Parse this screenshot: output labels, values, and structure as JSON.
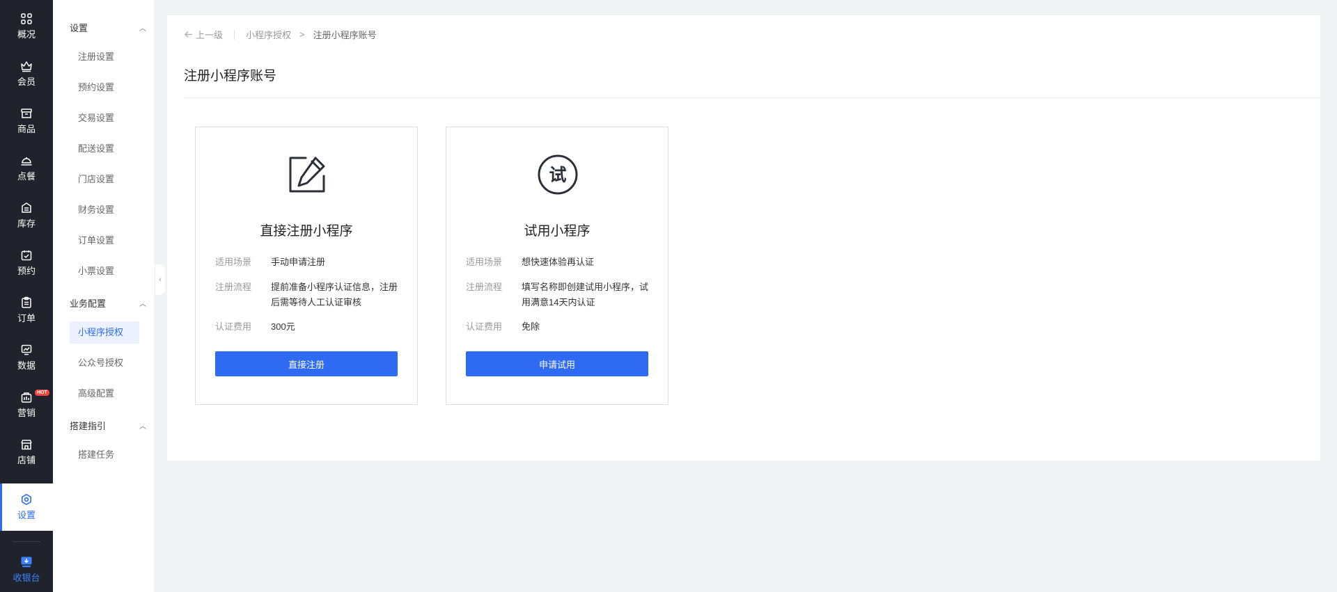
{
  "nav": {
    "items": [
      {
        "label": "概况",
        "icon": "grid-icon"
      },
      {
        "label": "会员",
        "icon": "crown-icon"
      },
      {
        "label": "商品",
        "icon": "shop-box-icon"
      },
      {
        "label": "点餐",
        "icon": "dish-icon"
      },
      {
        "label": "库存",
        "icon": "inventory-icon"
      },
      {
        "label": "预约",
        "icon": "calendar-check-icon"
      },
      {
        "label": "订单",
        "icon": "clipboard-icon"
      },
      {
        "label": "数据",
        "icon": "chart-icon"
      },
      {
        "label": "营销",
        "icon": "marketing-icon",
        "badge": "HOT"
      },
      {
        "label": "店铺",
        "icon": "store-icon"
      },
      {
        "label": "设置",
        "icon": "settings-icon",
        "active": true
      }
    ],
    "cashier": {
      "label": "收银台",
      "icon": "cashier-icon"
    }
  },
  "sidebar": {
    "groups": [
      {
        "label": "设置",
        "items": [
          "注册设置",
          "预约设置",
          "交易设置",
          "配送设置",
          "门店设置",
          "财务设置",
          "订单设置",
          "小票设置"
        ]
      },
      {
        "label": "业务配置",
        "items": [
          "小程序授权",
          "公众号授权",
          "高级配置"
        ]
      },
      {
        "label": "搭建指引",
        "items": [
          "搭建任务"
        ]
      }
    ],
    "active_item": "小程序授权"
  },
  "breadcrumb": {
    "back": "上一级",
    "parent": "小程序授权",
    "separator": ">",
    "current": "注册小程序账号"
  },
  "page_title": "注册小程序账号",
  "cards": [
    {
      "icon": "edit-document-icon",
      "title": "直接注册小程序",
      "rows": [
        {
          "key": "适用场景",
          "value": "手动申请注册"
        },
        {
          "key": "注册流程",
          "value": "提前准备小程序认证信息，注册后需等待人工认证审核"
        },
        {
          "key": "认证费用",
          "value": "300元"
        }
      ],
      "button": "直接注册"
    },
    {
      "icon": "trial-circle-icon",
      "icon_glyph": "试",
      "title": "试用小程序",
      "rows": [
        {
          "key": "适用场景",
          "value": "想快速体验再认证"
        },
        {
          "key": "注册流程",
          "value": "填写名称即创建试用小程序，试用满意14天内认证"
        },
        {
          "key": "认证费用",
          "value": "免除"
        }
      ],
      "button": "申请试用"
    }
  ],
  "colors": {
    "primary": "#2e6af2",
    "nav_bg": "#20232b",
    "page_bg": "#f2f3f5",
    "hot_badge": "#f0443c"
  }
}
